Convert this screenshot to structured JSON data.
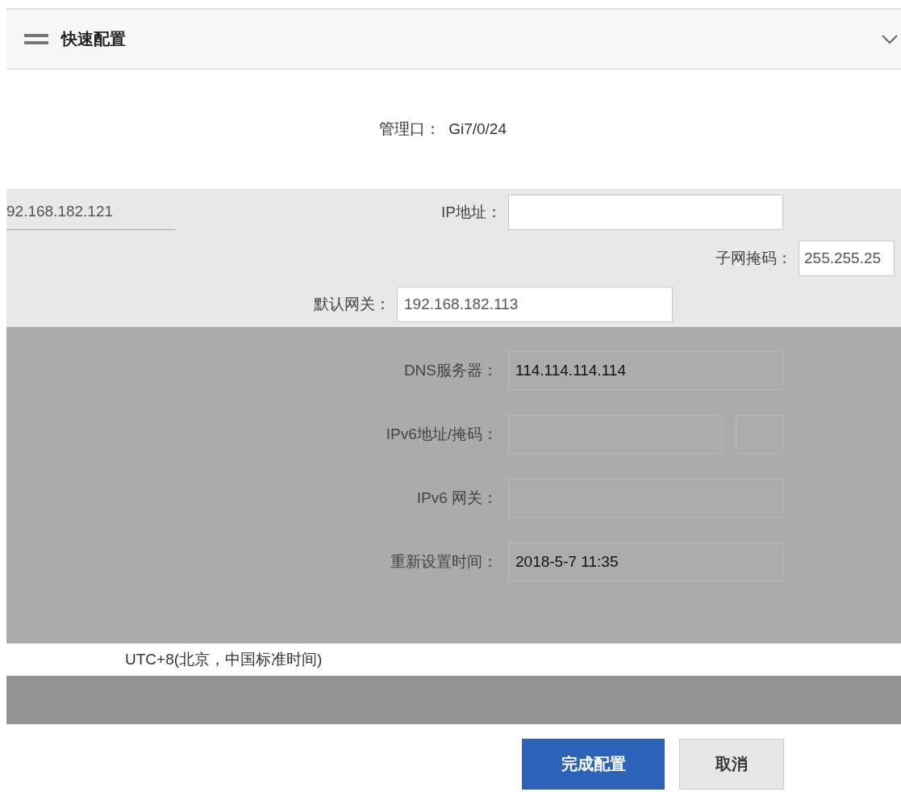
{
  "header": {
    "title": "快速配置"
  },
  "management_port": {
    "label": "管理口：",
    "value": "Gi7/0/24"
  },
  "light_rows": [
    {
      "kind": "left",
      "value": "92.168.182.121",
      "label": "IP地址："
    },
    {
      "kind": "right",
      "label": "子网掩码：",
      "value": "255.255.25"
    },
    {
      "kind": "mid",
      "label": "默认网关：",
      "value": "192.168.182.113"
    }
  ],
  "fields": [
    {
      "kind": "single",
      "label": "DNS服务器：",
      "value": "114.114.114.114"
    },
    {
      "kind": "pair",
      "label": "IPv6地址/掩码："
    },
    {
      "kind": "single",
      "label": "IPv6 网关："
    },
    {
      "kind": "single",
      "label": "重新设置时间：",
      "value": "2018-5-7 11:35"
    }
  ],
  "timezone": {
    "value": "UTC+8(北京，中国标准时间)"
  },
  "buttons": [
    {
      "label": "完成配置",
      "kind": "primary"
    },
    {
      "label": "取消",
      "kind": "secondary"
    }
  ]
}
